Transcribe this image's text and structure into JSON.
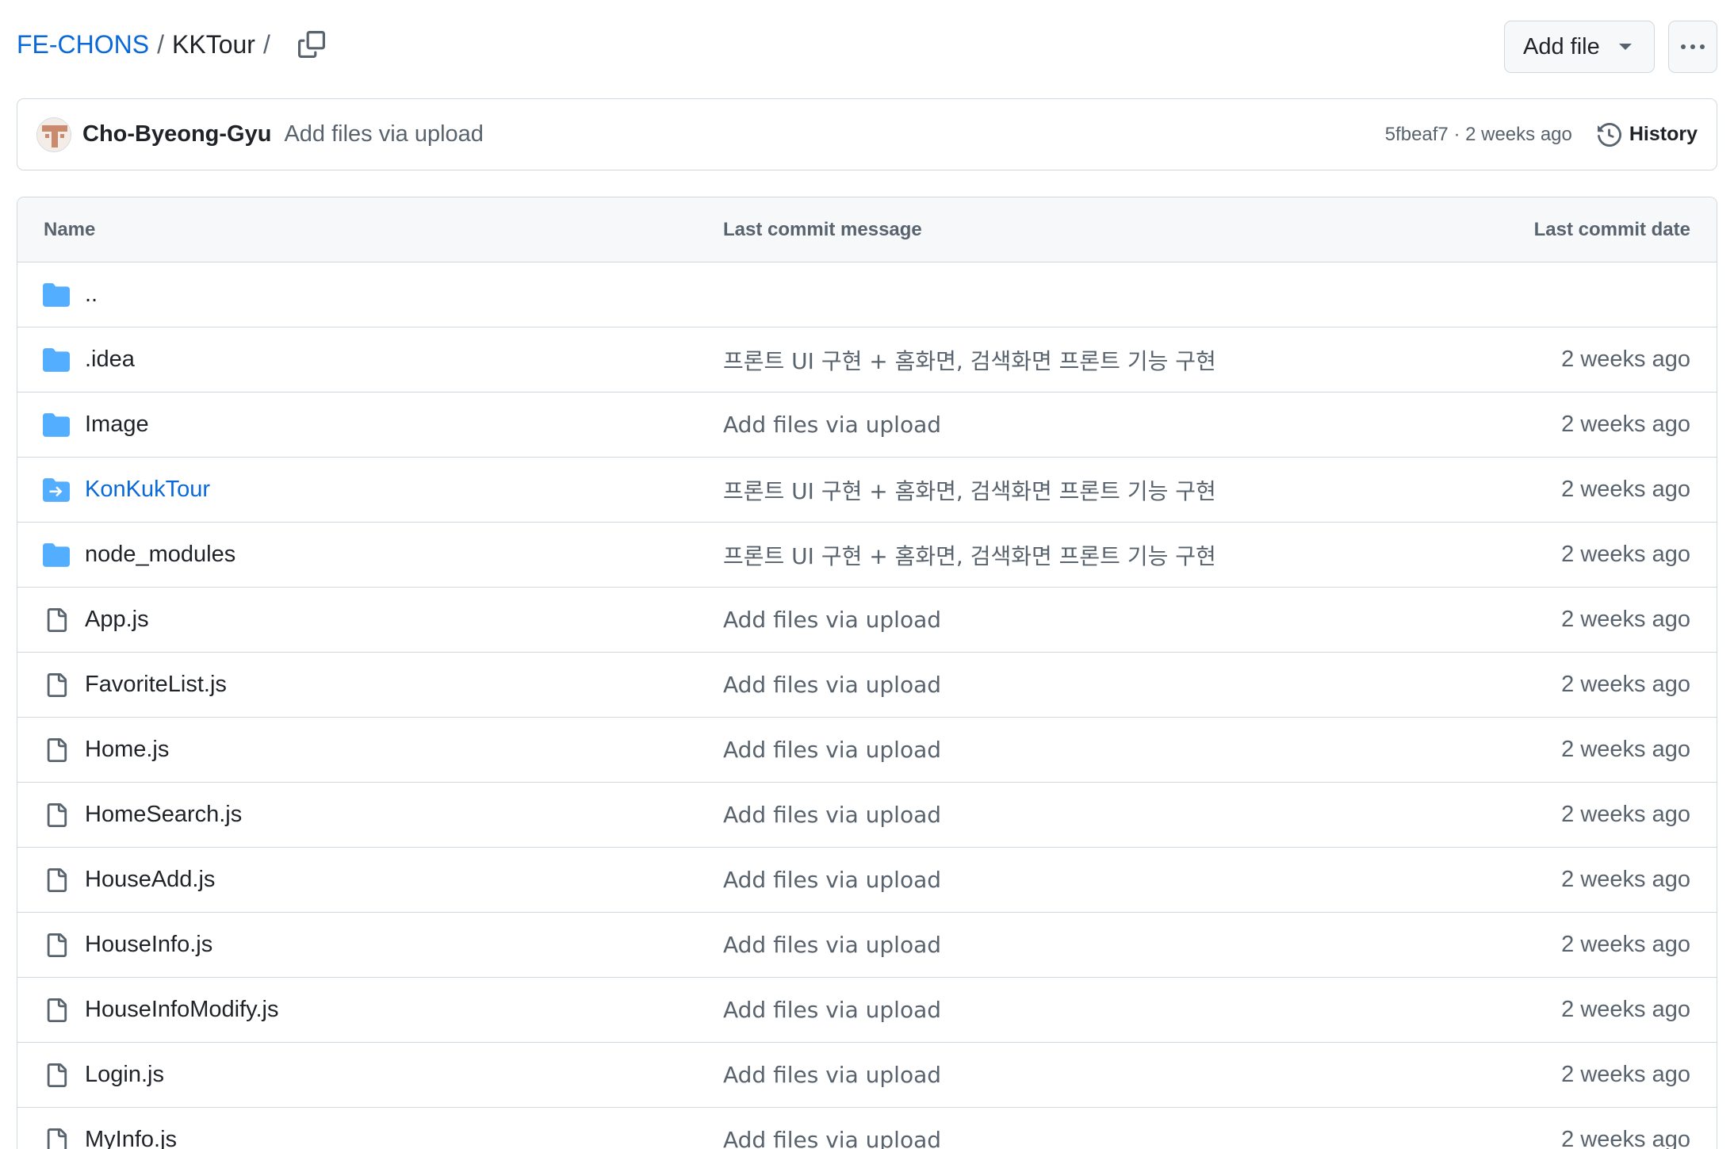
{
  "breadcrumb": {
    "owner": "FE-CHONS",
    "sep": "/",
    "repo": "KKTour",
    "trailing_sep": "/"
  },
  "header": {
    "add_file_label": "Add file"
  },
  "commit": {
    "author": "Cho-Byeong-Gyu",
    "message": "Add files via upload",
    "meta": "5fbeaf7 · 2 weeks ago",
    "history_label": "History"
  },
  "table": {
    "headers": {
      "name": "Name",
      "message": "Last commit message",
      "date": "Last commit date"
    },
    "parent": "..",
    "rows": [
      {
        "type": "folder",
        "name": ".idea",
        "message": "프론트 UI 구현 + 홈화면, 검색화면 프론트 기능 구현",
        "date": "2 weeks ago"
      },
      {
        "type": "folder",
        "name": "Image",
        "message": "Add files via upload",
        "date": "2 weeks ago"
      },
      {
        "type": "submodule",
        "name": "KonKukTour",
        "message": "프론트 UI 구현 + 홈화면, 검색화면 프론트 기능 구현",
        "date": "2 weeks ago"
      },
      {
        "type": "folder",
        "name": "node_modules",
        "message": "프론트 UI 구현 + 홈화면, 검색화면 프론트 기능 구현",
        "date": "2 weeks ago"
      },
      {
        "type": "file",
        "name": "App.js",
        "message": "Add files via upload",
        "date": "2 weeks ago"
      },
      {
        "type": "file",
        "name": "FavoriteList.js",
        "message": "Add files via upload",
        "date": "2 weeks ago"
      },
      {
        "type": "file",
        "name": "Home.js",
        "message": "Add files via upload",
        "date": "2 weeks ago"
      },
      {
        "type": "file",
        "name": "HomeSearch.js",
        "message": "Add files via upload",
        "date": "2 weeks ago"
      },
      {
        "type": "file",
        "name": "HouseAdd.js",
        "message": "Add files via upload",
        "date": "2 weeks ago"
      },
      {
        "type": "file",
        "name": "HouseInfo.js",
        "message": "Add files via upload",
        "date": "2 weeks ago"
      },
      {
        "type": "file",
        "name": "HouseInfoModify.js",
        "message": "Add files via upload",
        "date": "2 weeks ago"
      },
      {
        "type": "file",
        "name": "Login.js",
        "message": "Add files via upload",
        "date": "2 weeks ago"
      },
      {
        "type": "file",
        "name": "MyInfo.js",
        "message": "Add files via upload",
        "date": "2 weeks ago"
      }
    ]
  },
  "colors": {
    "link": "#0969da",
    "folder": "#54aeff",
    "muted": "#59636e",
    "border": "#d1d9e0"
  }
}
